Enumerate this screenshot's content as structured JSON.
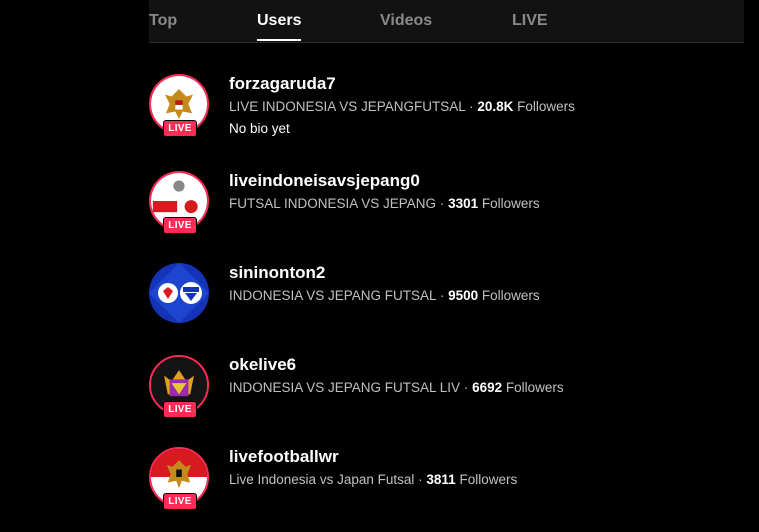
{
  "tabs": [
    {
      "label": "Top",
      "active": false
    },
    {
      "label": "Users",
      "active": true
    },
    {
      "label": "Videos",
      "active": false
    },
    {
      "label": "LIVE",
      "active": false
    }
  ],
  "live_badge": "LIVE",
  "separator": "·",
  "followers_label": "Followers",
  "accent_color": "#fe2c55",
  "users": [
    {
      "username": "forzagaruda7",
      "nickname": "LIVE INDONESIA VS JEPANGFUTSAL",
      "followers": "20.8K",
      "bio": "No bio yet",
      "live": true
    },
    {
      "username": "liveindoneisavsjepang0",
      "nickname": "FUTSAL INDONESIA VS JEPANG",
      "followers": "3301",
      "live": true
    },
    {
      "username": "sininonton2",
      "nickname": "INDONESIA VS JEPANG FUTSAL",
      "followers": "9500",
      "live": false
    },
    {
      "username": "okelive6",
      "nickname": "INDONESIA VS JEPANG FUTSAL LIV",
      "followers": "6692",
      "live": true
    },
    {
      "username": "livefootballwr",
      "nickname": "Live Indonesia vs Japan Futsal",
      "followers": "3811",
      "live": true
    }
  ]
}
